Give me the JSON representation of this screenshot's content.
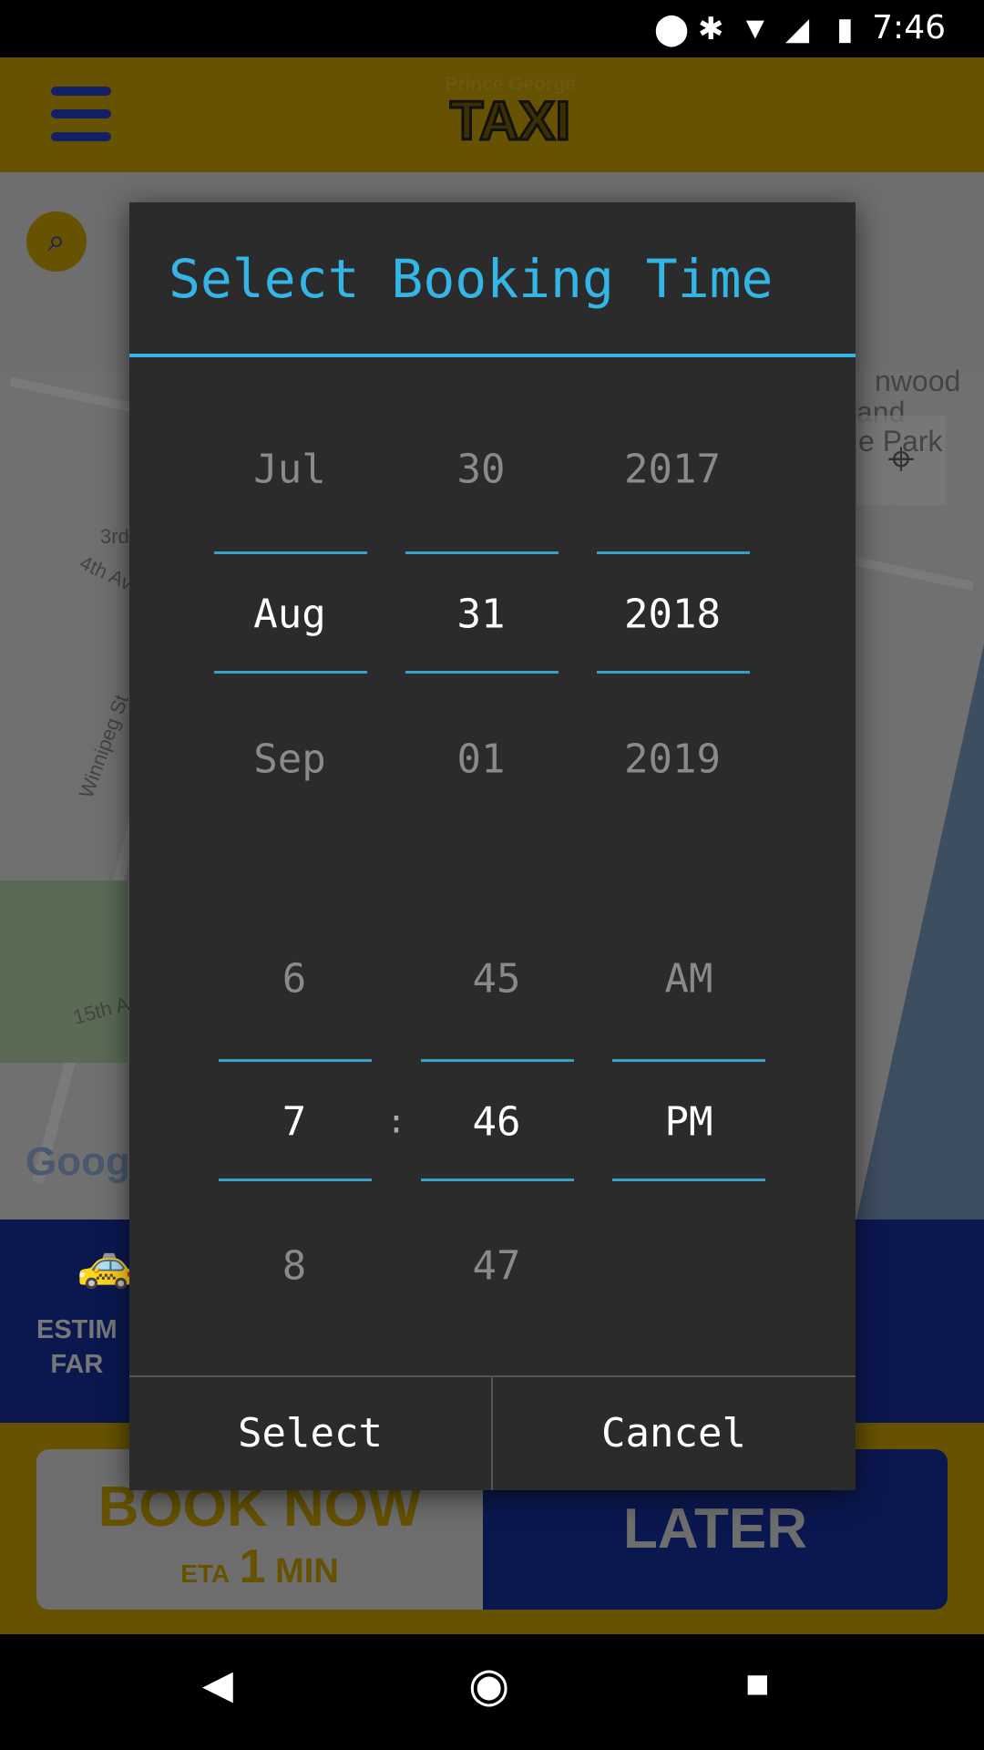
{
  "status_bar": {
    "time": "7:46",
    "icons": [
      "location-icon",
      "bluetooth-icon",
      "wifi-icon",
      "signal-icon",
      "battery-charging-icon"
    ]
  },
  "toolbar": {
    "logo_small": "Prince George",
    "logo_big": "TAXI"
  },
  "map": {
    "labels": [
      "3rd",
      "4th Av",
      "Winnipeg St",
      "15th A",
      "nwood",
      "and",
      "e Park"
    ],
    "attribution": "Goog"
  },
  "bottom": {
    "estimate_label_1": "ESTIM",
    "estimate_label_2": "FAR",
    "book_now": "BOOK NOW",
    "eta_prefix": "ETA",
    "eta_number": "1",
    "eta_unit": "MIN",
    "later": "LATER"
  },
  "dialog": {
    "title": "Select Booking Time",
    "date": {
      "month": {
        "prev": "Jul",
        "selected": "Aug",
        "next": "Sep"
      },
      "day": {
        "prev": "30",
        "selected": "31",
        "next": "01"
      },
      "year": {
        "prev": "2017",
        "selected": "2018",
        "next": "2019"
      }
    },
    "time": {
      "hour": {
        "prev": "6",
        "selected": "7",
        "next": "8"
      },
      "separator": ":",
      "minute": {
        "prev": "45",
        "selected": "46",
        "next": "47"
      },
      "ampm": {
        "prev": "AM",
        "selected": "PM"
      }
    },
    "select_label": "Select",
    "cancel_label": "Cancel"
  },
  "colors": {
    "accent": "#33b5e5",
    "dialog_bg": "#2b2b2b",
    "brand_yellow": "#f5c400",
    "brand_blue": "#1a2c9c"
  }
}
